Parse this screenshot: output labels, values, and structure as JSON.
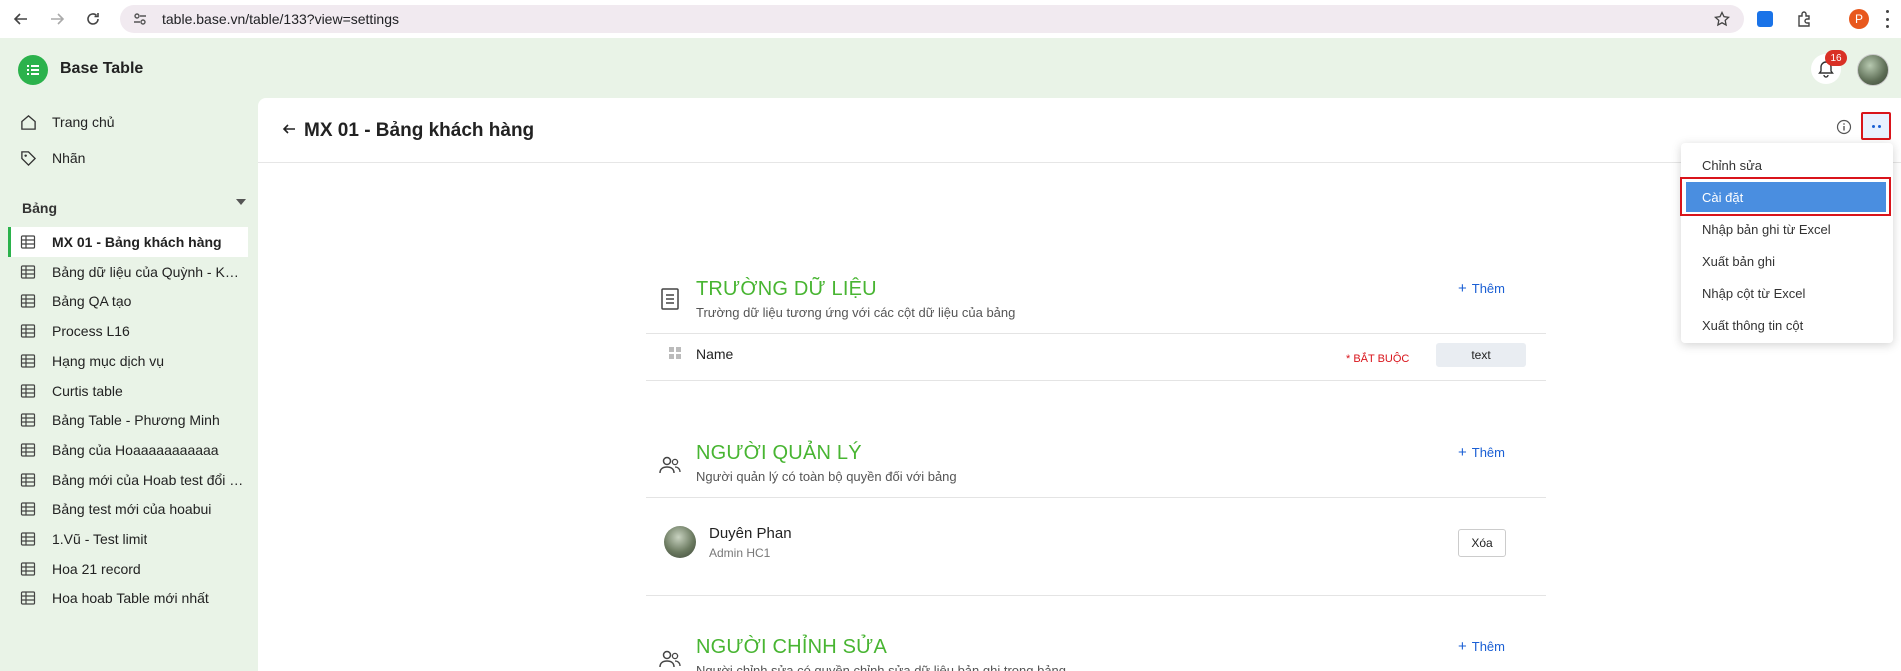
{
  "browser": {
    "url": "table.base.vn/table/133?view=settings",
    "profile_initial": "P"
  },
  "app": {
    "title": "Base Table",
    "notification_count": "16"
  },
  "sidebar": {
    "links": [
      {
        "label": "Trang chủ",
        "icon": "home-icon"
      },
      {
        "label": "Nhãn",
        "icon": "tag-icon"
      }
    ],
    "section_title": "Bảng",
    "tables": [
      {
        "label": "MX 01 - Bảng khách hàng",
        "active": true
      },
      {
        "label": "Bảng dữ liệu của Quỳnh - KHÁCH HÀNG",
        "active": false
      },
      {
        "label": "Bảng QA tạo",
        "active": false
      },
      {
        "label": "Process L16",
        "active": false
      },
      {
        "label": "Hạng mục dịch vụ",
        "active": false
      },
      {
        "label": "Curtis table",
        "active": false
      },
      {
        "label": "Bảng Table - Phương Minh",
        "active": false
      },
      {
        "label": "Bảng của Hoaaaaaaaaaaa",
        "active": false
      },
      {
        "label": "Bảng mới của Hoab test đổi tên",
        "active": false
      },
      {
        "label": "Bảng test mới của hoabui",
        "active": false
      },
      {
        "label": "1.Vũ - Test limit",
        "active": false
      },
      {
        "label": "Hoa 21 record",
        "active": false
      },
      {
        "label": "Hoa hoab Table mới nhất",
        "active": false
      }
    ]
  },
  "main": {
    "page_title": "MX 01 - Bảng khách hàng",
    "sections": {
      "fields": {
        "title": "TRƯỜNG DỮ LIỆU",
        "desc": "Trường dữ liệu tương ứng với các cột dữ liệu của bảng",
        "add_label": "Thêm",
        "rows": [
          {
            "name": "Name",
            "required_label": "* BẮT BUỘC",
            "type": "text"
          }
        ]
      },
      "managers": {
        "title": "NGƯỜI QUẢN LÝ",
        "desc": "Người quản lý có toàn bộ quyền đối với bảng",
        "add_label": "Thêm",
        "people": [
          {
            "name": "Duyên Phan",
            "role": "Admin HC1",
            "remove_label": "Xóa"
          }
        ]
      },
      "editors": {
        "title": "NGƯỜI CHỈNH SỬA",
        "desc": "Người chỉnh sửa có quyền chỉnh sửa dữ liệu bản ghi trong bảng",
        "add_label": "Thêm"
      }
    }
  },
  "menu": {
    "items": [
      {
        "label": "Chỉnh sửa",
        "selected": false
      },
      {
        "label": "Cài đặt",
        "selected": true
      },
      {
        "label": "Nhập bản ghi từ Excel",
        "selected": false
      },
      {
        "label": "Xuất bản ghi",
        "selected": false
      },
      {
        "label": "Nhập cột từ Excel",
        "selected": false
      },
      {
        "label": "Xuất thông tin cột",
        "selected": false
      }
    ]
  },
  "colors": {
    "brand_green": "#2bb24c",
    "section_title_green": "#48b532",
    "link_blue": "#1a5fd4",
    "menu_selected": "#4a8ee0",
    "highlight_red": "#d9141b"
  }
}
